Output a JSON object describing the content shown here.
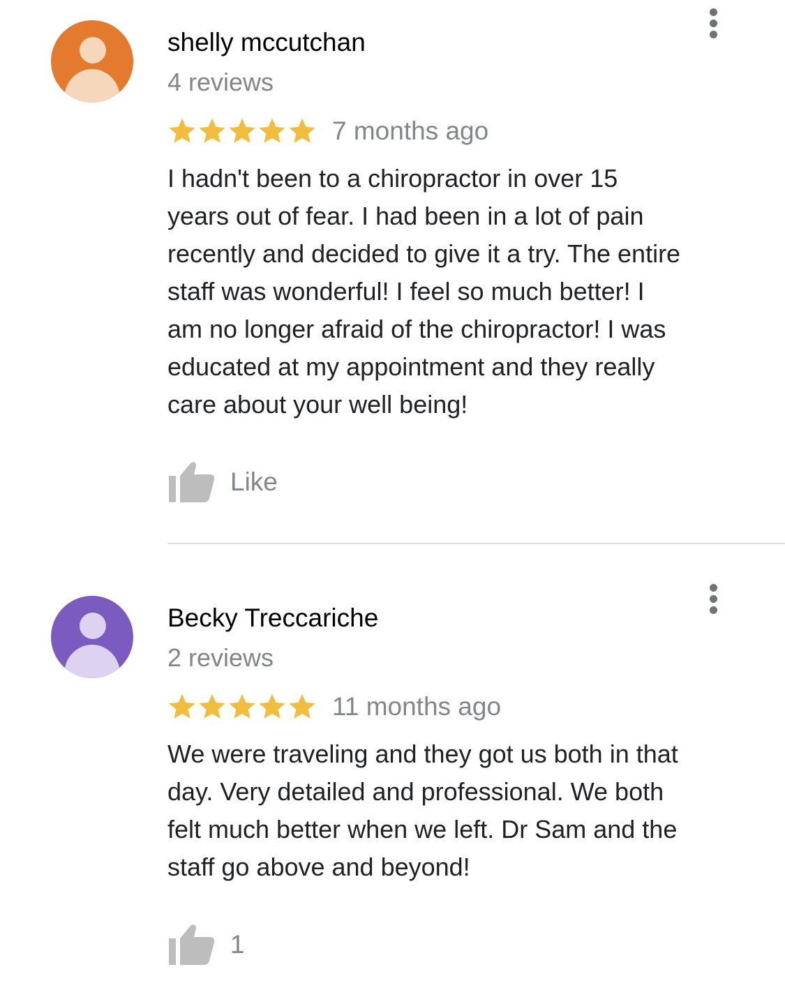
{
  "reviews": [
    {
      "reviewer_name": "shelly mccutchan",
      "review_count": "4 reviews",
      "rating": 5,
      "time_ago": "7 months ago",
      "text": "I hadn't been to a chiropractor in over 15\nyears out of fear. I had been in a lot of pain\nrecently and decided to give it a try. The entire\nstaff was wonderful! I feel so much better! I\nam no longer afraid of the chiropractor! I was\neducated at my appointment and they really\ncare about your well being!",
      "like_label": "Like",
      "avatar_color": "#e37a2d",
      "avatar_figure_color": "#f6d7bc"
    },
    {
      "reviewer_name": "Becky Treccariche",
      "review_count": "2 reviews",
      "rating": 5,
      "time_ago": "11 months ago",
      "text": "We were traveling and they got us both in that\nday.  Very detailed and professional. We both\nfelt much better when we left.  Dr Sam and the\nstaff go above and beyond!",
      "like_label": "1",
      "avatar_color": "#7b5bbf",
      "avatar_figure_color": "#ddd2f0"
    }
  ],
  "colors": {
    "star": "#f2bd3c",
    "secondary_text": "#80868b",
    "thumb_icon": "#bdbdbd",
    "more_icon": "#6f7377",
    "divider": "#e0e0e0"
  },
  "icons": {
    "avatar": "person-avatar-icon",
    "star": "star-icon",
    "like": "thumbs-up-icon",
    "more": "more-vertical-icon"
  }
}
